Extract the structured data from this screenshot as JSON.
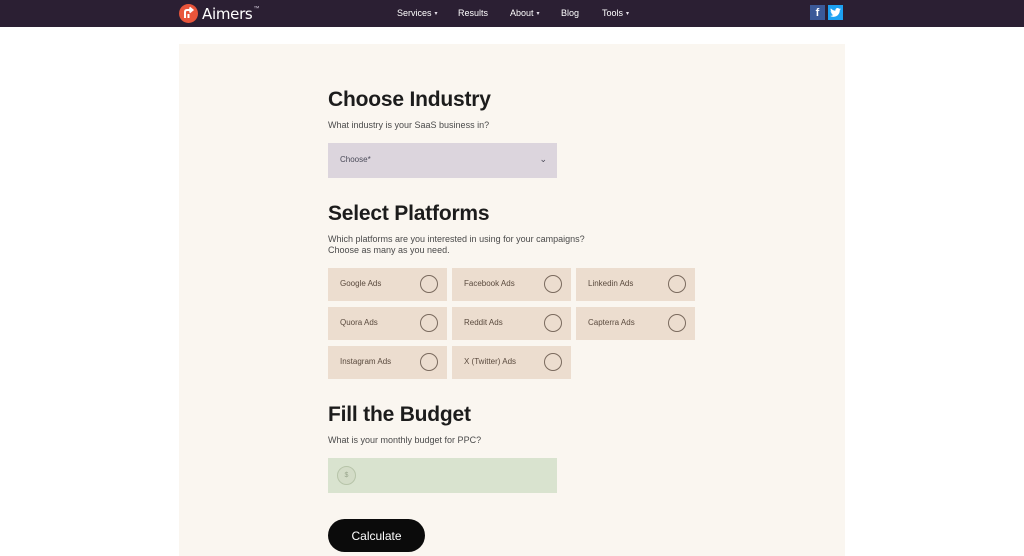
{
  "nav": {
    "logo_text": "Aimers",
    "logo_tm": "™",
    "links": [
      {
        "label": "Services",
        "caret": "▾"
      },
      {
        "label": "Results",
        "caret": ""
      },
      {
        "label": "About",
        "caret": "▾"
      },
      {
        "label": "Blog",
        "caret": ""
      },
      {
        "label": "Tools",
        "caret": "▾"
      }
    ],
    "social": {
      "facebook": "f",
      "twitter_icon": "twitter-icon"
    }
  },
  "industry": {
    "heading": "Choose Industry",
    "question": "What industry is your SaaS business in?",
    "select_value": "Choose*",
    "chevron": "⌄"
  },
  "platforms": {
    "heading": "Select Platforms",
    "question_line1": "Which platforms are you interested in using for your campaigns?",
    "question_line2": "Choose as many as you need.",
    "options": [
      "Google Ads",
      "Facebook Ads",
      "Linkedin Ads",
      "Quora Ads",
      "Reddit Ads",
      "Capterra Ads",
      "Instagram Ads",
      "X (Twitter) Ads"
    ]
  },
  "budget": {
    "heading": "Fill the Budget",
    "question": "What is your monthly budget for PPC?",
    "currency": "$"
  },
  "calculate_label": "Calculate",
  "colors": {
    "navbar": "#2b1f33",
    "brand": "#e8553b",
    "panel": "#faf6f0",
    "select": "#dcd5dd",
    "chip": "#ecddcf",
    "budget": "#d9e3cf",
    "button": "#0b0b0b"
  }
}
